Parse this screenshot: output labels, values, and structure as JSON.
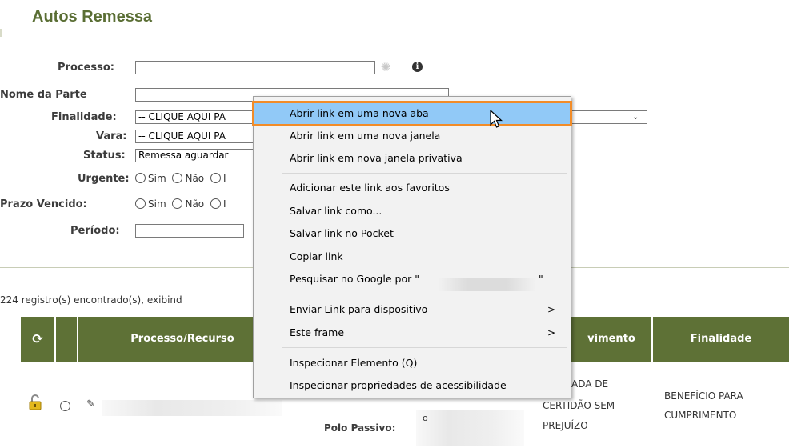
{
  "page": {
    "title": "Autos Remessa"
  },
  "form": {
    "processo_label": "Processo:",
    "processo_value": "",
    "nome_parte_label": "Nome da Parte",
    "nome_parte_value": "",
    "finalidade_label": "Finalidade:",
    "finalidade_value": "-- CLIQUE AQUI PA",
    "vara_label": "Vara:",
    "vara_value": "-- CLIQUE AQUI PA",
    "status_label": "Status:",
    "status_value": "Remessa aguardar",
    "urgente_label": "Urgente:",
    "prazo_label": "Prazo Vencido:",
    "periodo_label": "Período:",
    "periodo_value": "",
    "radio_sim": "Sim",
    "radio_nao": "Não",
    "radio_third": "I"
  },
  "results": {
    "count_text": "224 registro(s) encontrado(s), exibind"
  },
  "table": {
    "headers": {
      "processo_recurso": "Processo/Recurso",
      "movimento": "vimento",
      "finalidade": "Finalidade"
    },
    "row": {
      "movimento_text": "ADA DE\nCERTIDÃO SEM\nPREJUÍZO",
      "mov_l1": "ADA DE",
      "mov_l2": "CERTIDÃO SEM",
      "mov_l3": "PREJUÍZO",
      "fin_l1": "BENEFÍCIO PARA",
      "fin_l2": "CUMPRIMENTO",
      "polo_passivo_label": "Polo Passivo:",
      "polo_bullet": "o"
    }
  },
  "context_menu": {
    "items": [
      {
        "label": "Abrir link em uma nova aba"
      },
      {
        "label": "Abrir link em uma nova janela"
      },
      {
        "label": "Abrir link em nova janela privativa"
      },
      {
        "label": "Adicionar este link aos favoritos"
      },
      {
        "label": "Salvar link como..."
      },
      {
        "label": "Salvar link no Pocket"
      },
      {
        "label": "Copiar link"
      },
      {
        "label": "Pesquisar no Google por \""
      },
      {
        "label": "Enviar Link para dispositivo"
      },
      {
        "label": "Este frame"
      },
      {
        "label": "Inspecionar Elemento (Q)"
      },
      {
        "label": "Inspecionar propriedades de acessibilidade"
      }
    ],
    "search_close_quote": "\"",
    "submenu_arrow": ">"
  },
  "icons": {
    "spinner": "loading-spinner-icon",
    "info": "info-icon",
    "refresh": "refresh-icon",
    "lock": "padlock-open-icon",
    "pencil": "pencil-icon",
    "cursor": "mouse-pointer-icon"
  },
  "colors": {
    "title": "#5a6e34",
    "table_header": "#5e7136",
    "menu_highlight": "#91c9f7",
    "highlight_outline": "#f28c28"
  }
}
